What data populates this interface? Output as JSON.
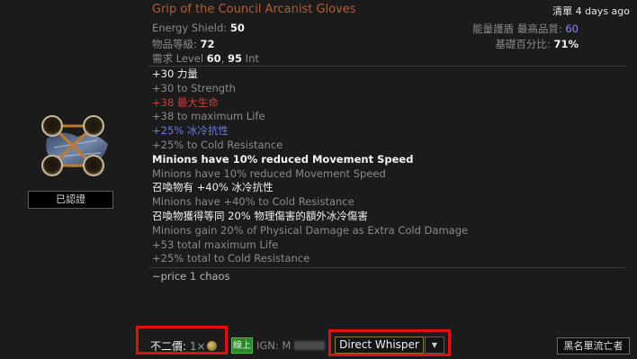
{
  "item": {
    "name": "Grip of the Council Arcanist Gloves",
    "listed": "清單 4 days ago",
    "properties": {
      "energy_shield_label": "Energy Shield:",
      "energy_shield_value": "50",
      "quality_label": "能量護盾 最高品質:",
      "quality_value": "60",
      "item_level_label": "物品等級:",
      "item_level_value": "72",
      "base_pct_label": "基礎百分比:",
      "base_pct_value": "71%",
      "requires_label": "需求 Level",
      "requires_level": "60",
      "requires_sep": ",",
      "requires_int": "95",
      "requires_int_label": "Int"
    },
    "mods": [
      {
        "text": "+30 力量",
        "style": "white"
      },
      {
        "text": "+30 to Strength",
        "style": "grey"
      },
      {
        "text": "+38 最大生命",
        "style": "red"
      },
      {
        "text": "+38 to maximum Life",
        "style": "grey"
      },
      {
        "text": "+25% 冰冷抗性",
        "style": "blue"
      },
      {
        "text": "+25% to Cold Resistance",
        "style": "grey"
      },
      {
        "text": "Minions have 10% reduced Movement Speed",
        "style": "bright"
      },
      {
        "text": "Minions have 10% reduced Movement Speed",
        "style": "grey"
      },
      {
        "text": "召喚物有 +40% 冰冷抗性",
        "style": "white"
      },
      {
        "text": "Minions have +40% to Cold Resistance",
        "style": "grey"
      },
      {
        "text": "召喚物獲得等同 20% 物理傷害的額外冰冷傷害",
        "style": "white"
      },
      {
        "text": "Minions gain 20% of Physical Damage as Extra Cold Damage",
        "style": "grey"
      },
      {
        "text": "+53 total maximum Life",
        "style": "grey"
      },
      {
        "text": "+25% total to Cold Resistance",
        "style": "grey"
      }
    ],
    "note": "~price 1 chaos",
    "verified_label": "已認證",
    "icon": "arcanist-gloves-icon"
  },
  "footer": {
    "price_label": "不二價:",
    "price_amount": "1×",
    "currency_icon": "chaos-orb-icon",
    "online_badge": "線上",
    "ign_label": "IGN: M",
    "whisper_label": "Direct Whisper",
    "whisper_caret": "▼",
    "blacklist_label": "黑名單流亡者"
  },
  "colors": {
    "name": "#b05e32",
    "highlight_box": "#e01010",
    "online": "#2a8a2a"
  }
}
